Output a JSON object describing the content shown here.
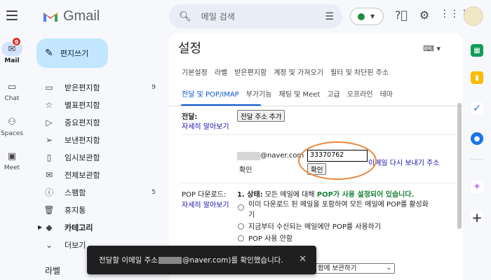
{
  "rail": {
    "items": [
      {
        "name": "Mail",
        "icon": "mail-icon",
        "badge": "9",
        "active": true
      },
      {
        "name": "Chat",
        "icon": "chat-icon"
      },
      {
        "name": "Spaces",
        "icon": "spaces-icon"
      },
      {
        "name": "Meet",
        "icon": "meet-icon"
      }
    ]
  },
  "header": {
    "logo_text": "Gmail",
    "search_placeholder": "메일 검색"
  },
  "compose": {
    "label": "편지쓰기"
  },
  "nav": {
    "items": [
      {
        "label": "받은편지함",
        "icon": "inbox-icon",
        "count": "9"
      },
      {
        "label": "별표편지함",
        "icon": "star-icon"
      },
      {
        "label": "중요편지함",
        "icon": "label-important-icon"
      },
      {
        "label": "보낸편지함",
        "icon": "send-icon"
      },
      {
        "label": "임시보관함",
        "icon": "draft-icon"
      },
      {
        "label": "전체보관함",
        "icon": "all-mail-icon"
      },
      {
        "label": "스팸함",
        "icon": "spam-icon",
        "count": "5"
      },
      {
        "label": "휴지통",
        "icon": "trash-icon"
      },
      {
        "label": "카테고리",
        "icon": "label-icon",
        "bold": true
      },
      {
        "label": "더보기",
        "icon": "chevron-down-icon"
      }
    ],
    "labels_heading": "라벨"
  },
  "settings": {
    "title": "설정",
    "tabs_row1": [
      "기본설정",
      "라벨",
      "받은편지함",
      "계정 및 가져오기",
      "필터 및 차단된 주소"
    ],
    "tabs_row2": [
      "전달 및 POP/IMAP",
      "부가기능",
      "채팅 및 Meet",
      "고급",
      "오프라인",
      "테마"
    ],
    "active_tab": "전달 및 POP/IMAP",
    "forwarding": {
      "label": "전달:",
      "learn_more": "자세히 알아보기",
      "add_button": "전달 주소 추가",
      "email_suffix": "@naver.com",
      "code_value": "33370762",
      "resend_link": "이메일 다시 보내기 주소",
      "confirm_label": "확인",
      "confirm_button": "확인"
    },
    "pop": {
      "label": "POP 다운로드:",
      "learn_more": "자세히 알아보기",
      "status_prefix": "1. 상태:",
      "status_mid": " 모든 메일에 대해 ",
      "status_highlight": "POP가 사용 설정되어 있습니다.",
      "options": [
        "이미 다운로드 된 메일을 포함하여 모든 메일에 POP를 활성화\n기",
        "지금부터 수신되는 메일에만 POP를 사용하기",
        "POP 사용 안함"
      ],
      "when_text": "경우",
      "select_value": "함에 보관하기"
    }
  },
  "toast": {
    "prefix": "전달할 이메일 주소",
    "suffix": "@naver.com)를 확인했습니다."
  },
  "colors": {
    "accent": "#0b57d0",
    "compose_bg": "#c2e7ff",
    "highlight_ring": "#e8883a",
    "pop_green": "#188038"
  }
}
